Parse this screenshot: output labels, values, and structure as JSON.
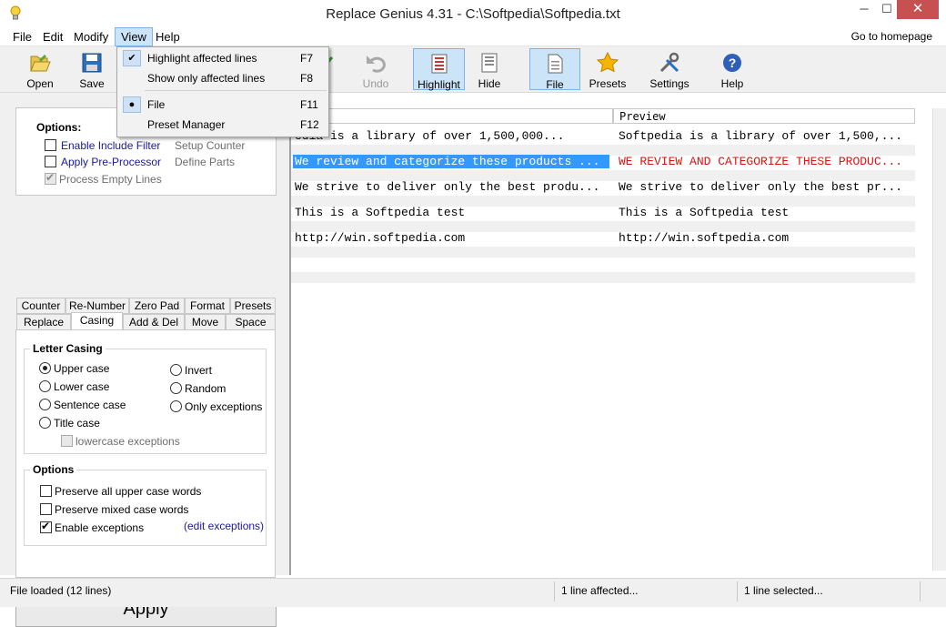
{
  "window": {
    "title": "Replace Genius 4.31 - C:\\Softpedia\\Softpedia.txt",
    "min": "─",
    "max": "☐",
    "close": "✕"
  },
  "menu": {
    "items": [
      "File",
      "Edit",
      "Modify",
      "View",
      "Help"
    ],
    "goto_homepage": "Go to homepage"
  },
  "toolbar": {
    "open": "Open",
    "save": "Save",
    "apply_partial": "ly",
    "undo": "Undo",
    "highlight": "Highlight",
    "hide": "Hide",
    "file": "File",
    "presets": "Presets",
    "settings": "Settings",
    "help": "Help"
  },
  "view_menu": [
    {
      "label": "Highlight affected lines",
      "key": "F7",
      "mark": "✔"
    },
    {
      "label": "Show only affected lines",
      "key": "F8",
      "mark": ""
    },
    {
      "label": "File",
      "key": "F11",
      "mark": "●"
    },
    {
      "label": "Preset Manager",
      "key": "F12",
      "mark": ""
    }
  ],
  "options": {
    "header": "Options:",
    "enable_include_filter": "Enable Include Filter",
    "apply_preprocessor": "Apply Pre-Processor",
    "process_empty_lines": "Process Empty Lines",
    "setup_counter": "Setup Counter",
    "define_parts": "Define Parts"
  },
  "tabs_row1": [
    "Counter",
    "Re-Number",
    "Zero Pad",
    "Format",
    "Presets"
  ],
  "tabs_row2": [
    "Replace",
    "Casing",
    "Add & Del",
    "Move",
    "Space"
  ],
  "casing": {
    "letter_casing": "Letter Casing",
    "upper": "Upper case",
    "lower": "Lower case",
    "sentence": "Sentence case",
    "title": "Title case",
    "invert": "Invert",
    "random": "Random",
    "only_exceptions": "Only exceptions",
    "lowercase_exceptions": "lowercase exceptions",
    "options_header": "Options",
    "preserve_upper": "Preserve all upper case words",
    "preserve_mixed": "Preserve mixed case words",
    "enable_exceptions": "Enable exceptions",
    "edit_exceptions": "(edit exceptions)"
  },
  "apply_button": "Apply",
  "grid": {
    "col_current": "ent",
    "col_preview": "Preview",
    "rows": [
      {
        "current": "edia is a library of over 1,500,000...",
        "preview": "Softpedia is a library of over 1,500,..."
      },
      {
        "current": "We review and categorize these products ...",
        "preview": "WE REVIEW AND CATEGORIZE THESE PRODUC..."
      },
      {
        "current": "We strive to deliver only the best produ...",
        "preview": "We strive to deliver only the best pr..."
      },
      {
        "current": "This is a Softpedia test",
        "preview": "This is a Softpedia test"
      },
      {
        "current": "http://win.softpedia.com",
        "preview": "http://win.softpedia.com"
      }
    ]
  },
  "status": {
    "loaded": "File loaded  (12 lines)",
    "affected": "1 line affected...",
    "selected": "1 line selected..."
  }
}
